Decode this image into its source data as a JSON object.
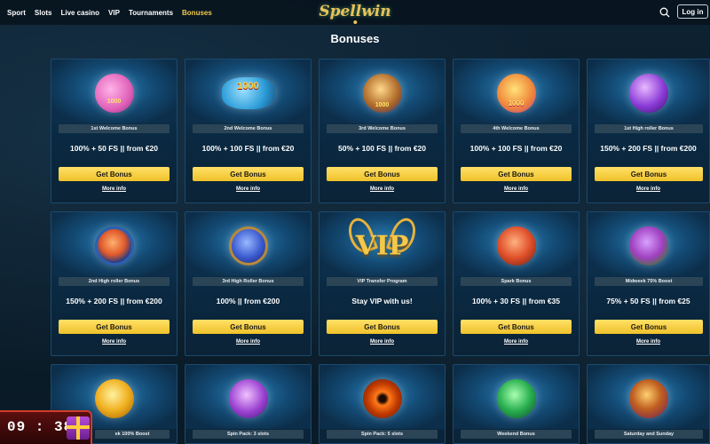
{
  "header": {
    "nav": [
      "Sport",
      "Slots",
      "Live casino",
      "VIP",
      "Tournaments",
      "Bonuses"
    ],
    "active_nav": "Bonuses",
    "logo": "Spellwin",
    "login_label": "Log in",
    "search_icon": "search-icon"
  },
  "page_title": "Bonuses",
  "card_actions": {
    "get_label": "Get Bonus",
    "more_label": "More info"
  },
  "cards_row1": [
    {
      "tag": "1st Welcome Bonus",
      "offer": "100% + 50 FS || from €20",
      "art_text": "1000"
    },
    {
      "tag": "2nd Welcome Bonus",
      "offer": "100% + 100 FS || from €20",
      "art_text": "1000"
    },
    {
      "tag": "3rd Welcome Bonus",
      "offer": "50% + 100 FS || from €20",
      "art_text": "1000"
    },
    {
      "tag": "4th Welcome Bonus",
      "offer": "100% + 100 FS || from €20",
      "art_text": "1000"
    },
    {
      "tag": "1st High roller Bonus",
      "offer": "150% + 200 FS || from €200"
    }
  ],
  "cards_row2": [
    {
      "tag": "2nd High roller Bonus",
      "offer": "150% + 200 FS || from €200"
    },
    {
      "tag": "3rd High Roller Bonus",
      "offer": "100% || from €200"
    },
    {
      "tag": "VIP Transfer Program",
      "offer": "Stay VIP with us!",
      "art_text": "VIP"
    },
    {
      "tag": "Spark Bonus",
      "offer": "100% + 30 FS || from €35"
    },
    {
      "tag": "Midweek 75% Boost",
      "offer": "75% + 50 FS || from €25"
    }
  ],
  "cards_row3": [
    {
      "tag": "ek 100% Boost"
    },
    {
      "tag": "Spin Pack: 3 slots"
    },
    {
      "tag": "Spin Pack: 5 slots"
    },
    {
      "tag": "Weekend Bonus"
    },
    {
      "tag": "Saturday and Sunday"
    }
  ],
  "timer": {
    "value": "09 : 38"
  },
  "colors": {
    "accent": "#f2c94c",
    "button": "#f5c933",
    "card_bg": "#0d3350"
  }
}
